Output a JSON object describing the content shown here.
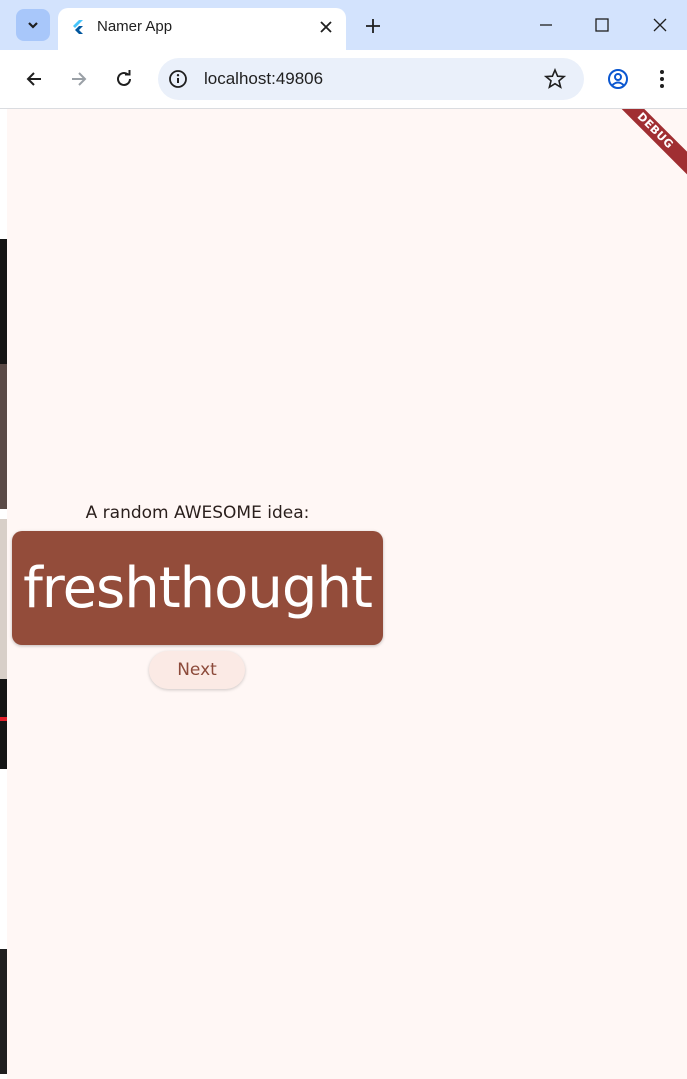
{
  "browser": {
    "tab": {
      "title": "Namer App",
      "favicon": "flutter-icon"
    },
    "address": {
      "url": "localhost:49806"
    },
    "icons": [
      "tab-search-icon",
      "close-icon",
      "plus-icon",
      "minimize-icon",
      "maximize-icon",
      "window-close-icon",
      "back-icon",
      "forward-icon",
      "reload-icon",
      "info-icon",
      "star-icon",
      "profile-icon",
      "menu-icon"
    ]
  },
  "app": {
    "debug_banner": "DEBUG",
    "label": "A random AWESOME idea:",
    "idea": "freshthought",
    "next_button": "Next",
    "colors": {
      "primary": "#934c3a",
      "background": "#fff7f5",
      "button_bg": "#fbeae5"
    }
  }
}
